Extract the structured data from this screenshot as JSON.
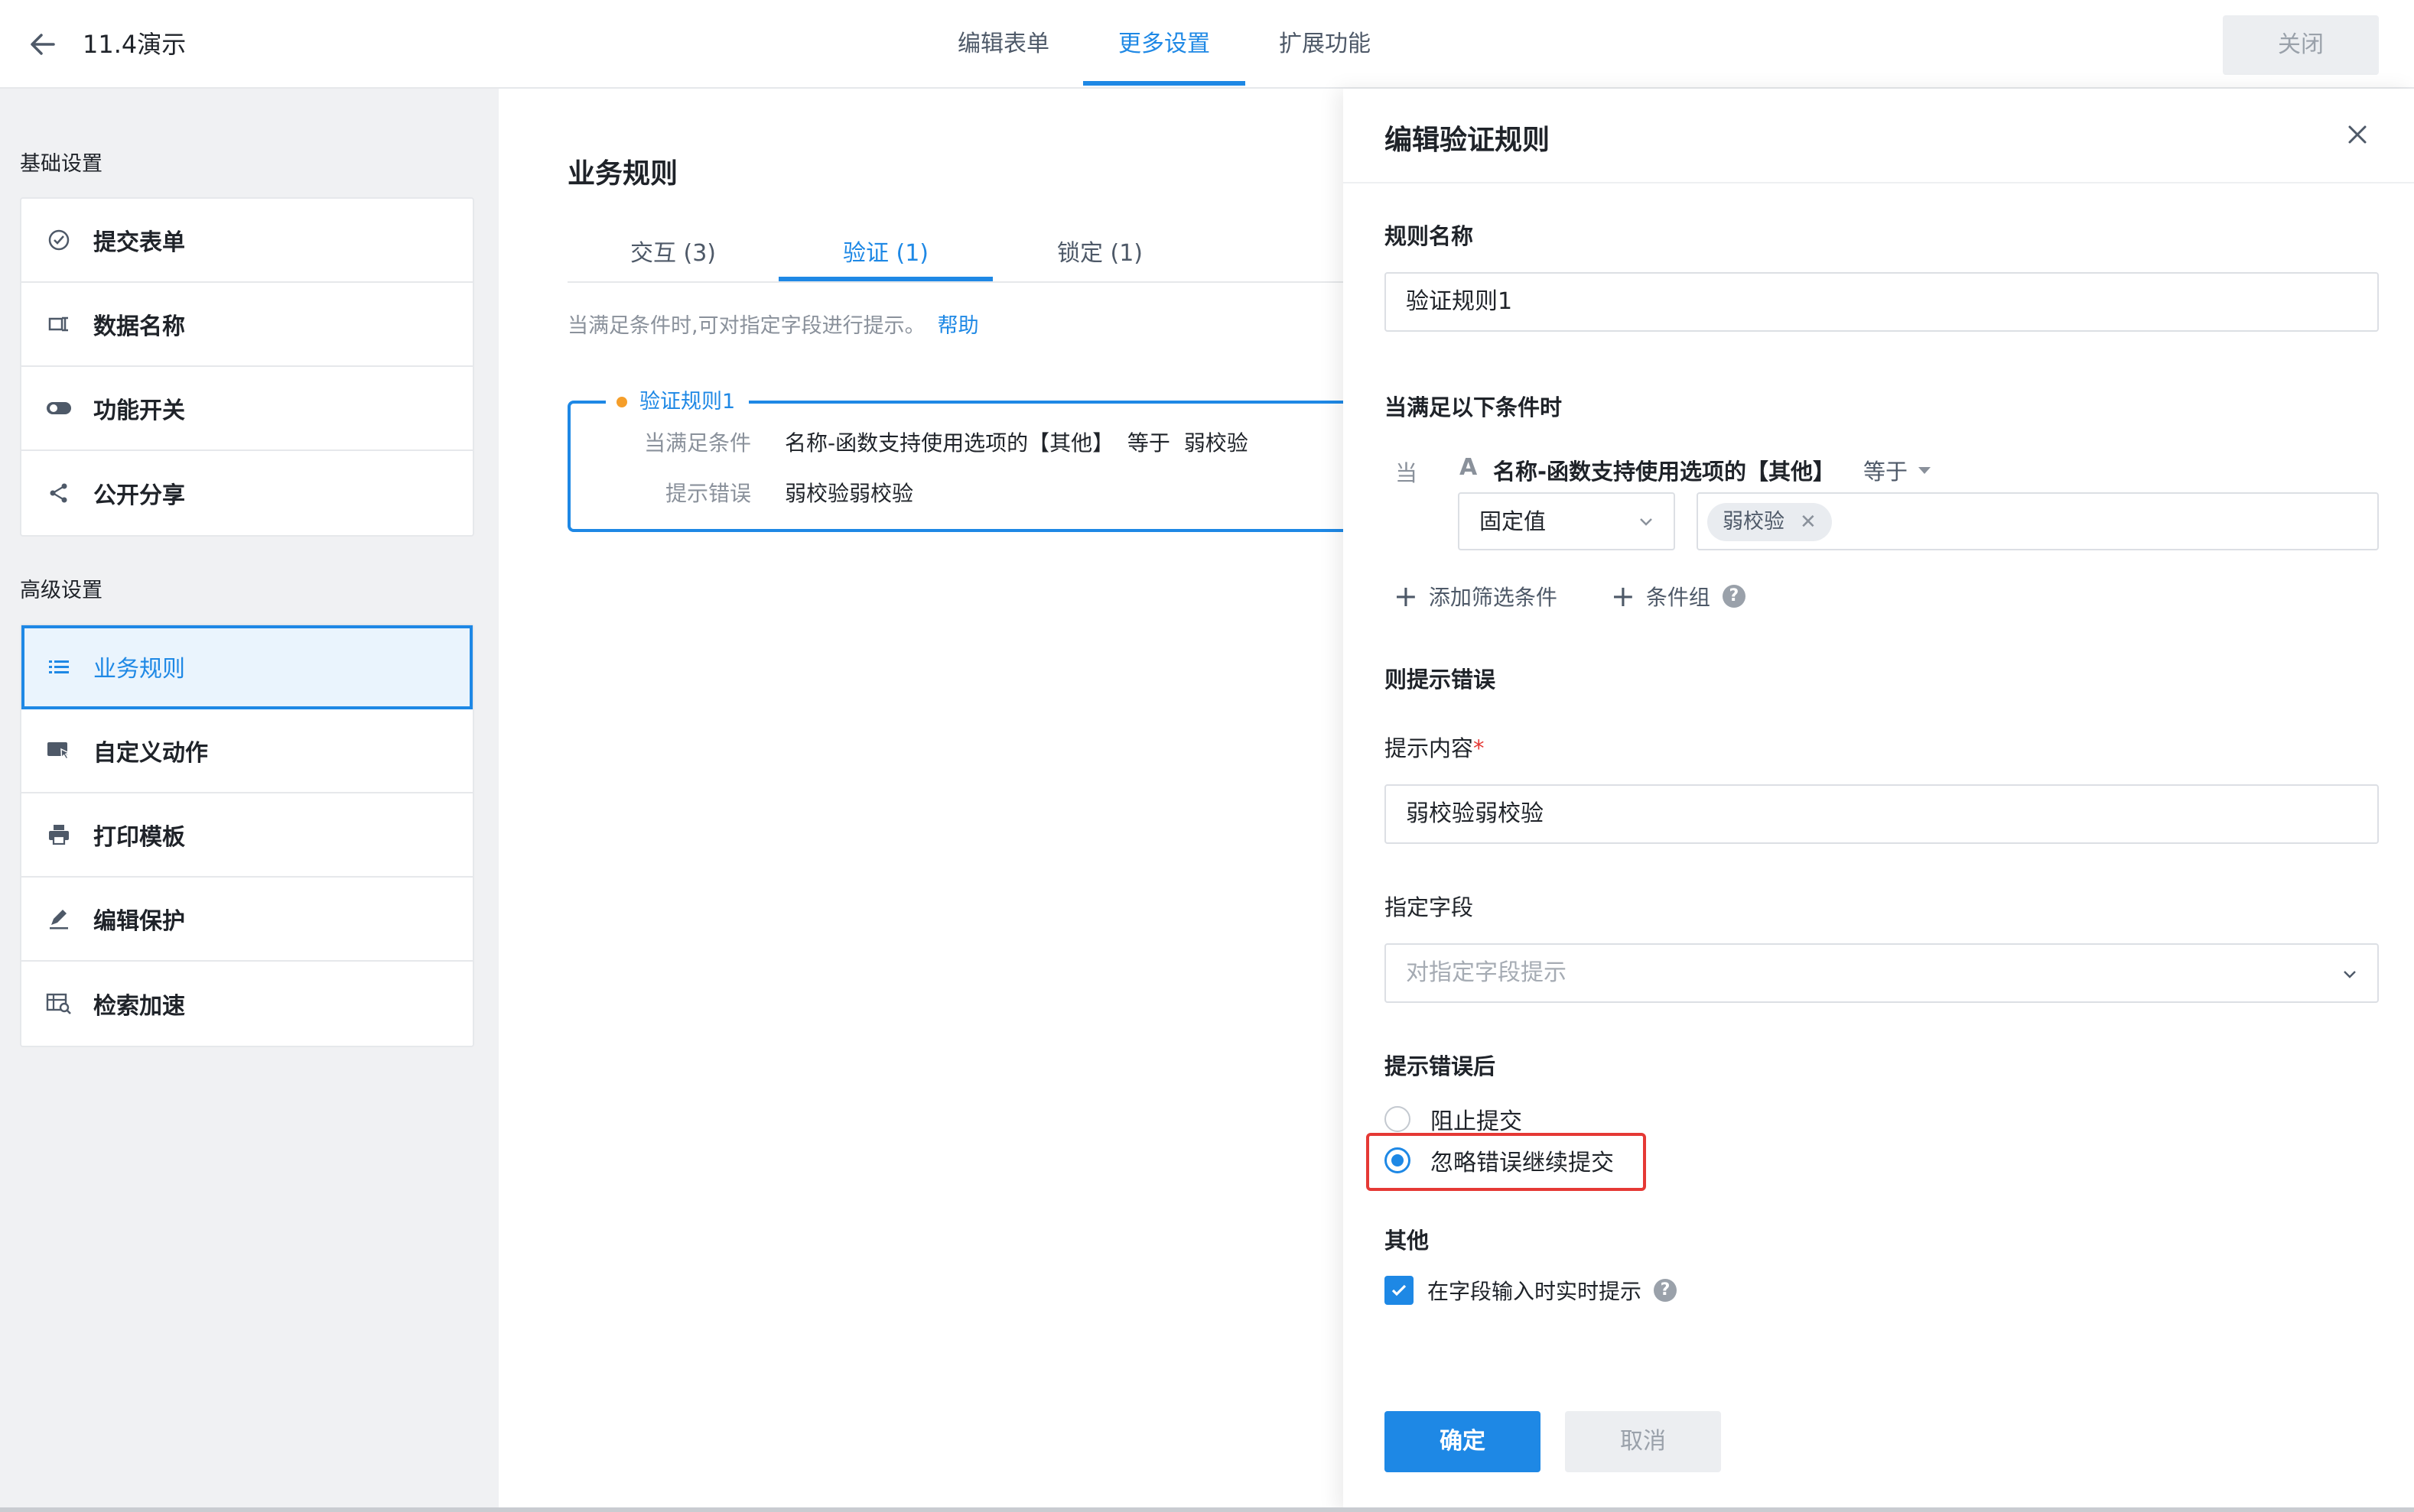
{
  "topbar": {
    "title": "11.4演示",
    "tabs": [
      {
        "label": "编辑表单",
        "active": false
      },
      {
        "label": "更多设置",
        "active": true
      },
      {
        "label": "扩展功能",
        "active": false
      }
    ],
    "close_label": "关闭"
  },
  "sidebar": {
    "basic_title": "基础设置",
    "basic_items": [
      {
        "label": "提交表单",
        "icon": "check-circle-icon"
      },
      {
        "label": "数据名称",
        "icon": "label-tag-icon"
      },
      {
        "label": "功能开关",
        "icon": "toggle-icon"
      },
      {
        "label": "公开分享",
        "icon": "share-icon"
      }
    ],
    "advanced_title": "高级设置",
    "advanced_items": [
      {
        "label": "业务规则",
        "icon": "list-icon",
        "active": true
      },
      {
        "label": "自定义动作",
        "icon": "cursor-window-icon"
      },
      {
        "label": "打印模板",
        "icon": "printer-icon"
      },
      {
        "label": "编辑保护",
        "icon": "pen-icon"
      },
      {
        "label": "检索加速",
        "icon": "search-table-icon"
      }
    ]
  },
  "content": {
    "title": "业务规则",
    "tabs": [
      {
        "label": "交互 (3)",
        "active": false
      },
      {
        "label": "验证 (1)",
        "active": true
      },
      {
        "label": "锁定 (1)",
        "active": false
      }
    ],
    "hint": "当满足条件时,可对指定字段进行提示。",
    "help_link": "帮助",
    "rule": {
      "name": "验证规则1",
      "condition_key": "当满足条件",
      "condition_value": "名称-函数支持使用选项的【其他】  等于  弱校验",
      "error_key": "提示错误",
      "error_value": "弱校验弱校验"
    }
  },
  "panel": {
    "title": "编辑验证规则",
    "rule_name_label": "规则名称",
    "rule_name_value": "验证规则1",
    "condition_label": "当满足以下条件时",
    "condition": {
      "when": "当",
      "field_type_icon": "A",
      "field": "名称-函数支持使用选项的【其他】",
      "operator": "等于",
      "value_type": "固定值",
      "value_tag": "弱校验"
    },
    "add_filter": "添加筛选条件",
    "add_group": "条件组",
    "then_label": "则提示错误",
    "message_label": "提示内容",
    "required_mark": "*",
    "message_value": "弱校验弱校验",
    "field_label": "指定字段",
    "field_placeholder": "对指定字段提示",
    "after_label": "提示错误后",
    "options": [
      {
        "label": "阻止提交",
        "selected": false
      },
      {
        "label": "忽略错误继续提交",
        "selected": true
      }
    ],
    "other_label": "其他",
    "realtime_label": "在字段输入时实时提示",
    "realtime_checked": true,
    "confirm_label": "确定",
    "cancel_label": "取消"
  },
  "colors": {
    "accent": "#1e88e5",
    "highlight": "#e53935",
    "badge_dot": "#f59e2a"
  }
}
